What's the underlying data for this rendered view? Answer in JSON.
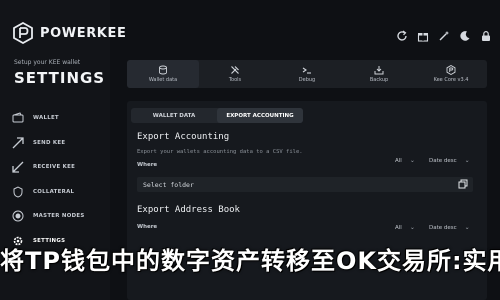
{
  "brand": {
    "name": "POWERKEE"
  },
  "sidebar": {
    "subtitle": "Setup your KEE wallet",
    "title": "SETTINGS",
    "items": [
      {
        "label": "WALLET",
        "icon": "wallet-icon"
      },
      {
        "label": "SEND KEE",
        "icon": "send-icon"
      },
      {
        "label": "RECEIVE KEE",
        "icon": "receive-icon"
      },
      {
        "label": "COLLATERAL",
        "icon": "collateral-icon"
      },
      {
        "label": "MASTER NODES",
        "icon": "master-nodes-icon"
      },
      {
        "label": "SETTINGS",
        "icon": "settings-gear-icon",
        "active": true
      }
    ]
  },
  "topbar": {
    "icons": [
      "refresh-icon",
      "gift-icon",
      "magic-icon",
      "moon-icon",
      "lock-icon"
    ]
  },
  "categories": [
    {
      "label": "Wallet data",
      "icon": "database-icon",
      "active": true
    },
    {
      "label": "Tools",
      "icon": "tools-icon"
    },
    {
      "label": "Debug",
      "icon": "debug-icon"
    },
    {
      "label": "Backup",
      "icon": "backup-icon"
    },
    {
      "label": "Kee Core v3.4",
      "icon": "kee-core-icon"
    }
  ],
  "subtabs": [
    {
      "label": "WALLET DATA"
    },
    {
      "label": "EXPORT ACCOUNTING",
      "active": true
    }
  ],
  "export_accounting": {
    "title": "Export Accounting",
    "desc": "Export your wallets accounting data to a CSV file.",
    "where": "Where",
    "filter_all": "All",
    "sort": "Date desc",
    "folder_placeholder": "Select folder"
  },
  "export_address_book": {
    "title": "Export Address Book",
    "where": "Where",
    "filter_all": "All",
    "sort": "Date desc"
  },
  "banner": {
    "text": "将TP钱包中的数字资产转移至OK交易所:实用"
  },
  "colors": {
    "accent": "#ffffff",
    "background": "#0e1014",
    "panel": "#16191e"
  }
}
